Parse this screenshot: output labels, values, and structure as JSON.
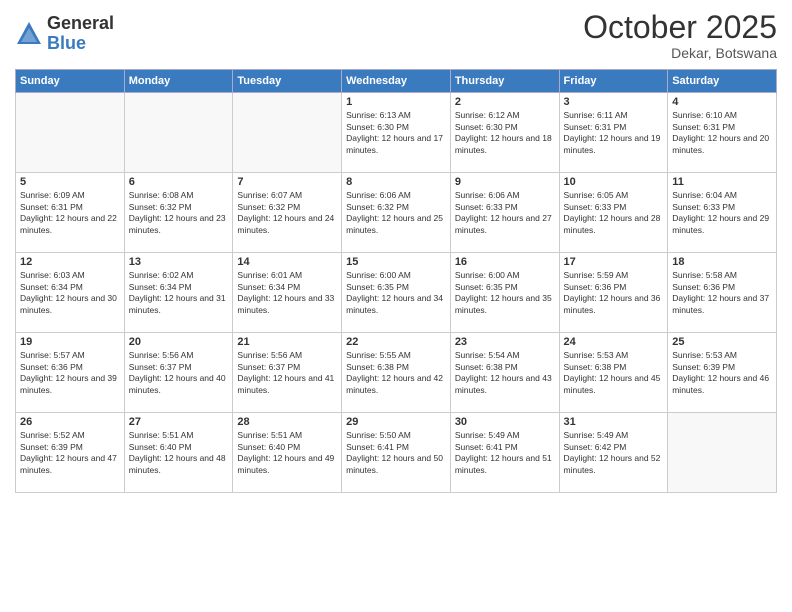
{
  "logo": {
    "general": "General",
    "blue": "Blue"
  },
  "header": {
    "month": "October 2025",
    "location": "Dekar, Botswana"
  },
  "weekdays": [
    "Sunday",
    "Monday",
    "Tuesday",
    "Wednesday",
    "Thursday",
    "Friday",
    "Saturday"
  ],
  "weeks": [
    [
      {
        "num": "",
        "empty": true
      },
      {
        "num": "",
        "empty": true
      },
      {
        "num": "",
        "empty": true
      },
      {
        "num": "1",
        "sunrise": "6:13 AM",
        "sunset": "6:30 PM",
        "daylight": "12 hours and 17 minutes."
      },
      {
        "num": "2",
        "sunrise": "6:12 AM",
        "sunset": "6:30 PM",
        "daylight": "12 hours and 18 minutes."
      },
      {
        "num": "3",
        "sunrise": "6:11 AM",
        "sunset": "6:31 PM",
        "daylight": "12 hours and 19 minutes."
      },
      {
        "num": "4",
        "sunrise": "6:10 AM",
        "sunset": "6:31 PM",
        "daylight": "12 hours and 20 minutes."
      }
    ],
    [
      {
        "num": "5",
        "sunrise": "6:09 AM",
        "sunset": "6:31 PM",
        "daylight": "12 hours and 22 minutes."
      },
      {
        "num": "6",
        "sunrise": "6:08 AM",
        "sunset": "6:32 PM",
        "daylight": "12 hours and 23 minutes."
      },
      {
        "num": "7",
        "sunrise": "6:07 AM",
        "sunset": "6:32 PM",
        "daylight": "12 hours and 24 minutes."
      },
      {
        "num": "8",
        "sunrise": "6:06 AM",
        "sunset": "6:32 PM",
        "daylight": "12 hours and 25 minutes."
      },
      {
        "num": "9",
        "sunrise": "6:06 AM",
        "sunset": "6:33 PM",
        "daylight": "12 hours and 27 minutes."
      },
      {
        "num": "10",
        "sunrise": "6:05 AM",
        "sunset": "6:33 PM",
        "daylight": "12 hours and 28 minutes."
      },
      {
        "num": "11",
        "sunrise": "6:04 AM",
        "sunset": "6:33 PM",
        "daylight": "12 hours and 29 minutes."
      }
    ],
    [
      {
        "num": "12",
        "sunrise": "6:03 AM",
        "sunset": "6:34 PM",
        "daylight": "12 hours and 30 minutes."
      },
      {
        "num": "13",
        "sunrise": "6:02 AM",
        "sunset": "6:34 PM",
        "daylight": "12 hours and 31 minutes."
      },
      {
        "num": "14",
        "sunrise": "6:01 AM",
        "sunset": "6:34 PM",
        "daylight": "12 hours and 33 minutes."
      },
      {
        "num": "15",
        "sunrise": "6:00 AM",
        "sunset": "6:35 PM",
        "daylight": "12 hours and 34 minutes."
      },
      {
        "num": "16",
        "sunrise": "6:00 AM",
        "sunset": "6:35 PM",
        "daylight": "12 hours and 35 minutes."
      },
      {
        "num": "17",
        "sunrise": "5:59 AM",
        "sunset": "6:36 PM",
        "daylight": "12 hours and 36 minutes."
      },
      {
        "num": "18",
        "sunrise": "5:58 AM",
        "sunset": "6:36 PM",
        "daylight": "12 hours and 37 minutes."
      }
    ],
    [
      {
        "num": "19",
        "sunrise": "5:57 AM",
        "sunset": "6:36 PM",
        "daylight": "12 hours and 39 minutes."
      },
      {
        "num": "20",
        "sunrise": "5:56 AM",
        "sunset": "6:37 PM",
        "daylight": "12 hours and 40 minutes."
      },
      {
        "num": "21",
        "sunrise": "5:56 AM",
        "sunset": "6:37 PM",
        "daylight": "12 hours and 41 minutes."
      },
      {
        "num": "22",
        "sunrise": "5:55 AM",
        "sunset": "6:38 PM",
        "daylight": "12 hours and 42 minutes."
      },
      {
        "num": "23",
        "sunrise": "5:54 AM",
        "sunset": "6:38 PM",
        "daylight": "12 hours and 43 minutes."
      },
      {
        "num": "24",
        "sunrise": "5:53 AM",
        "sunset": "6:38 PM",
        "daylight": "12 hours and 45 minutes."
      },
      {
        "num": "25",
        "sunrise": "5:53 AM",
        "sunset": "6:39 PM",
        "daylight": "12 hours and 46 minutes."
      }
    ],
    [
      {
        "num": "26",
        "sunrise": "5:52 AM",
        "sunset": "6:39 PM",
        "daylight": "12 hours and 47 minutes."
      },
      {
        "num": "27",
        "sunrise": "5:51 AM",
        "sunset": "6:40 PM",
        "daylight": "12 hours and 48 minutes."
      },
      {
        "num": "28",
        "sunrise": "5:51 AM",
        "sunset": "6:40 PM",
        "daylight": "12 hours and 49 minutes."
      },
      {
        "num": "29",
        "sunrise": "5:50 AM",
        "sunset": "6:41 PM",
        "daylight": "12 hours and 50 minutes."
      },
      {
        "num": "30",
        "sunrise": "5:49 AM",
        "sunset": "6:41 PM",
        "daylight": "12 hours and 51 minutes."
      },
      {
        "num": "31",
        "sunrise": "5:49 AM",
        "sunset": "6:42 PM",
        "daylight": "12 hours and 52 minutes."
      },
      {
        "num": "",
        "empty": true
      }
    ]
  ]
}
